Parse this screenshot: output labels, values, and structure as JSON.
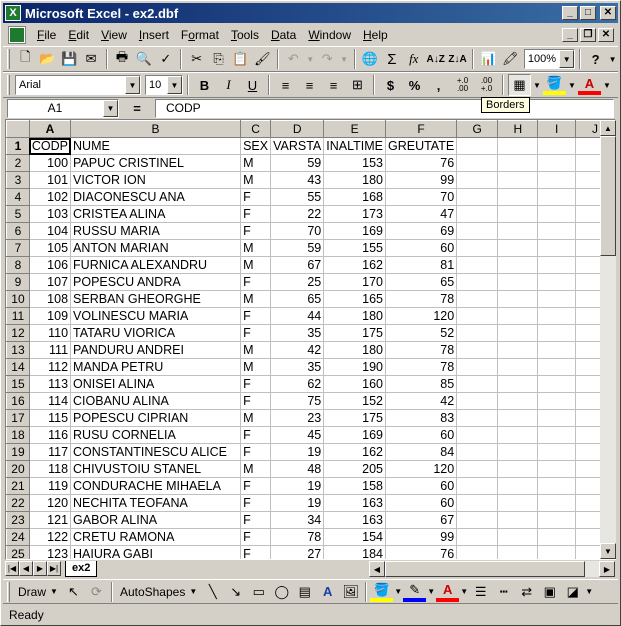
{
  "window": {
    "title": "Microsoft Excel - ex2.dbf",
    "app_icon": "excel-icon"
  },
  "menu": [
    {
      "label": "File",
      "u": "F",
      "rest": "ile"
    },
    {
      "label": "Edit",
      "u": "E",
      "rest": "dit"
    },
    {
      "label": "View",
      "u": "V",
      "rest": "iew"
    },
    {
      "label": "Insert",
      "u": "I",
      "rest": "nsert"
    },
    {
      "label": "Format",
      "u": "o",
      "pre": "F",
      "rest": "rmat"
    },
    {
      "label": "Tools",
      "u": "T",
      "rest": "ools"
    },
    {
      "label": "Data",
      "u": "D",
      "rest": "ata"
    },
    {
      "label": "Window",
      "u": "W",
      "rest": "indow"
    },
    {
      "label": "Help",
      "u": "H",
      "rest": "elp"
    }
  ],
  "standard_toolbar": {
    "zoom": "100%",
    "help": "?"
  },
  "formatting_toolbar": {
    "font": "Arial",
    "size": "10",
    "bold": "B",
    "italic": "I",
    "underline": "U",
    "currency": "$",
    "percent": "%",
    "comma": ",",
    "inc_decimal": "+.0\n.00",
    "dec_decimal": ".00\n+.0",
    "tooltip": "Borders"
  },
  "formula_bar": {
    "name_box": "A1",
    "equals": "=",
    "formula": "CODP"
  },
  "columns": [
    "A",
    "B",
    "C",
    "D",
    "E",
    "F",
    "G",
    "H",
    "I",
    "J"
  ],
  "header_row": [
    "CODP",
    "NUME",
    "SEX",
    "VARSTA",
    "INALTIME",
    "GREUTATE"
  ],
  "rows": [
    [
      "100",
      "PAPUC  CRISTINEL",
      "M",
      "59",
      "153",
      "76"
    ],
    [
      "101",
      "VICTOR   ION",
      "M",
      "43",
      "180",
      "99"
    ],
    [
      "102",
      "DIACONESCU  ANA",
      "F",
      "55",
      "168",
      "70"
    ],
    [
      "103",
      "CRISTEA   ALINA",
      "F",
      "22",
      "173",
      "47"
    ],
    [
      "104",
      "RUSSU   MARIA",
      "F",
      "70",
      "169",
      "69"
    ],
    [
      "105",
      "ANTON   MARIAN",
      "M",
      "59",
      "155",
      "60"
    ],
    [
      "106",
      "FURNICA  ALEXANDRU",
      "M",
      "67",
      "162",
      "81"
    ],
    [
      "107",
      "POPESCU ANDRA",
      "F",
      "25",
      "170",
      "65"
    ],
    [
      "108",
      "SERBAN GHEORGHE",
      "M",
      "65",
      "165",
      "78"
    ],
    [
      "109",
      "VOLINESCU MARIA",
      "F",
      "44",
      "180",
      "120"
    ],
    [
      "110",
      "TATARU VIORICA",
      "F",
      "35",
      "175",
      "52"
    ],
    [
      "111",
      "PANDURU ANDREI",
      "M",
      "42",
      "180",
      "78"
    ],
    [
      "112",
      "MANDA PETRU",
      "M",
      "35",
      "190",
      "78"
    ],
    [
      "113",
      "ONISEI ALINA",
      "F",
      "62",
      "160",
      "85"
    ],
    [
      "114",
      "CIOBANU ALINA",
      "F",
      "75",
      "152",
      "42"
    ],
    [
      "115",
      "POPESCU  CIPRIAN",
      "M",
      "23",
      "175",
      "83"
    ],
    [
      "116",
      "RUSU  CORNELIA",
      "F",
      "45",
      "169",
      "60"
    ],
    [
      "117",
      "CONSTANTINESCU ALICE",
      "F",
      "19",
      "162",
      "84"
    ],
    [
      "118",
      "CHIVUSTOIU  STANEL",
      "M",
      "48",
      "205",
      "120"
    ],
    [
      "119",
      "CONDURACHE  MIHAELA",
      "F",
      "19",
      "158",
      "60"
    ],
    [
      "120",
      "NECHITA  TEOFANA",
      "F",
      "19",
      "163",
      "60"
    ],
    [
      "121",
      "GABOR ALINA",
      "F",
      "34",
      "163",
      "67"
    ],
    [
      "122",
      "CRETU RAMONA",
      "F",
      "78",
      "154",
      "99"
    ],
    [
      "123",
      "HAIURA GABI",
      "F",
      "27",
      "184",
      "76"
    ]
  ],
  "sheet_tab": "ex2",
  "drawing_toolbar": {
    "draw": "Draw",
    "autoshapes": "AutoShapes"
  },
  "status": "Ready"
}
